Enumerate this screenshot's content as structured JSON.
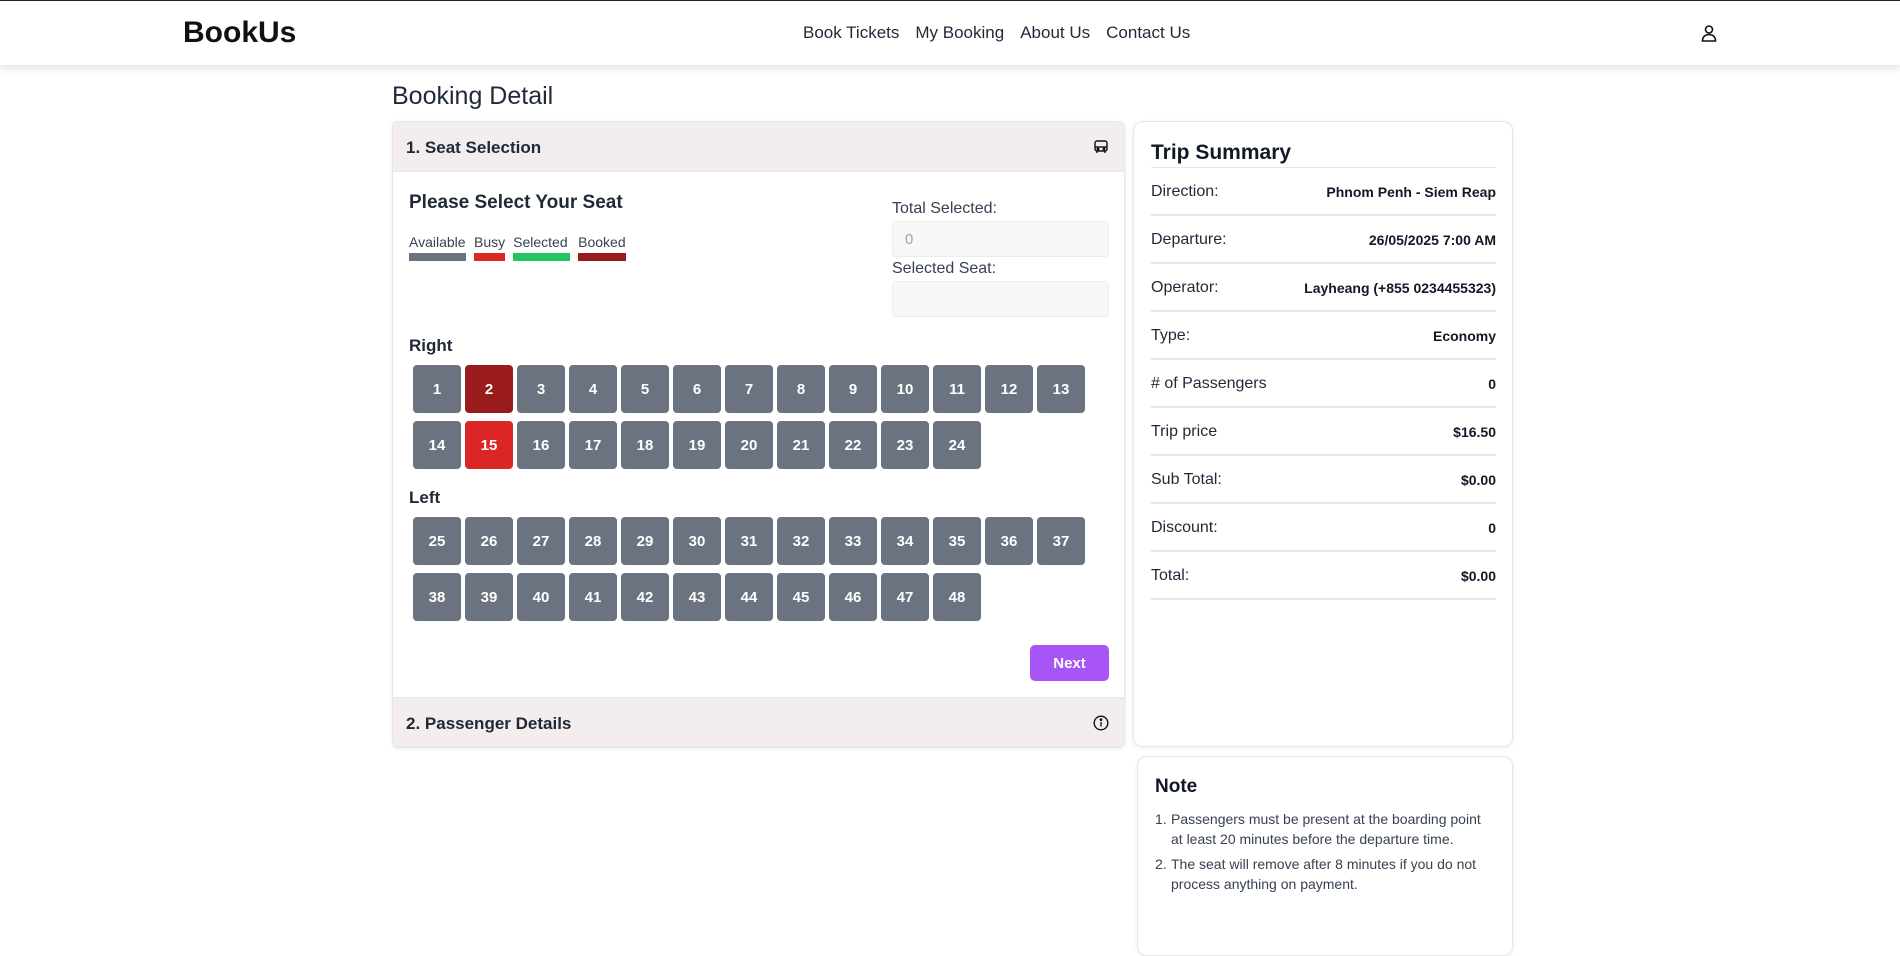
{
  "header": {
    "logo": "BookUs",
    "nav": [
      "Book Tickets",
      "My Booking",
      "About Us",
      "Contact Us"
    ]
  },
  "page": {
    "title": "Booking Detail"
  },
  "seat_section": {
    "title": "1. Seat Selection",
    "heading": "Please Select Your Seat",
    "legend": [
      {
        "label": "Available",
        "color": "#6b7280"
      },
      {
        "label": "Busy",
        "color": "#dc2626"
      },
      {
        "label": "Selected",
        "color": "#22c55e"
      },
      {
        "label": "Booked",
        "color": "#991b1b"
      }
    ],
    "total_selected_label": "Total Selected:",
    "total_selected_value": "0",
    "selected_seat_label": "Selected Seat:",
    "selected_seat_value": "",
    "right_label": "Right",
    "left_label": "Left",
    "right_rows": [
      [
        {
          "n": "1",
          "s": "available"
        },
        {
          "n": "2",
          "s": "booked"
        },
        {
          "n": "3",
          "s": "available"
        },
        {
          "n": "4",
          "s": "available"
        },
        {
          "n": "5",
          "s": "available"
        },
        {
          "n": "6",
          "s": "available"
        },
        {
          "n": "7",
          "s": "available"
        },
        {
          "n": "8",
          "s": "available"
        },
        {
          "n": "9",
          "s": "available"
        },
        {
          "n": "10",
          "s": "available"
        },
        {
          "n": "11",
          "s": "available"
        },
        {
          "n": "12",
          "s": "available"
        },
        {
          "n": "13",
          "s": "available"
        }
      ],
      [
        {
          "n": "14",
          "s": "available"
        },
        {
          "n": "15",
          "s": "busy"
        },
        {
          "n": "16",
          "s": "available"
        },
        {
          "n": "17",
          "s": "available"
        },
        {
          "n": "18",
          "s": "available"
        },
        {
          "n": "19",
          "s": "available"
        },
        {
          "n": "20",
          "s": "available"
        },
        {
          "n": "21",
          "s": "available"
        },
        {
          "n": "22",
          "s": "available"
        },
        {
          "n": "23",
          "s": "available"
        },
        {
          "n": "24",
          "s": "available"
        }
      ]
    ],
    "left_rows": [
      [
        {
          "n": "25",
          "s": "available"
        },
        {
          "n": "26",
          "s": "available"
        },
        {
          "n": "27",
          "s": "available"
        },
        {
          "n": "28",
          "s": "available"
        },
        {
          "n": "29",
          "s": "available"
        },
        {
          "n": "30",
          "s": "available"
        },
        {
          "n": "31",
          "s": "available"
        },
        {
          "n": "32",
          "s": "available"
        },
        {
          "n": "33",
          "s": "available"
        },
        {
          "n": "34",
          "s": "available"
        },
        {
          "n": "35",
          "s": "available"
        },
        {
          "n": "36",
          "s": "available"
        },
        {
          "n": "37",
          "s": "available"
        }
      ],
      [
        {
          "n": "38",
          "s": "available"
        },
        {
          "n": "39",
          "s": "available"
        },
        {
          "n": "40",
          "s": "available"
        },
        {
          "n": "41",
          "s": "available"
        },
        {
          "n": "42",
          "s": "available"
        },
        {
          "n": "43",
          "s": "available"
        },
        {
          "n": "44",
          "s": "available"
        },
        {
          "n": "45",
          "s": "available"
        },
        {
          "n": "46",
          "s": "available"
        },
        {
          "n": "47",
          "s": "available"
        },
        {
          "n": "48",
          "s": "available"
        }
      ]
    ],
    "next_label": "Next"
  },
  "passenger_section": {
    "title": "2. Passenger Details"
  },
  "summary": {
    "title": "Trip Summary",
    "rows": [
      {
        "label": "Direction:",
        "value": "Phnom Penh - Siem Reap"
      },
      {
        "label": "Departure:",
        "value": "26/05/2025 7:00 AM"
      },
      {
        "label": "Operator:",
        "value": "Layheang (+855 0234455323)"
      },
      {
        "label": "Type:",
        "value": "Economy"
      },
      {
        "label": "# of Passengers",
        "value": "0"
      },
      {
        "label": "Trip price",
        "value": "$16.50"
      },
      {
        "label": "Sub Total:",
        "value": "$0.00"
      },
      {
        "label": "Discount:",
        "value": "0"
      },
      {
        "label": "Total:",
        "value": "$0.00"
      }
    ]
  },
  "note": {
    "title": "Note",
    "items": [
      "Passengers must be present at the boarding point at least 20 minutes before the departure time.",
      "The seat will remove after 8 minutes if you do not process anything on payment."
    ]
  },
  "icons": {
    "user": "user-icon",
    "seat_section": "bus-icon",
    "passenger_section": "info-icon"
  }
}
